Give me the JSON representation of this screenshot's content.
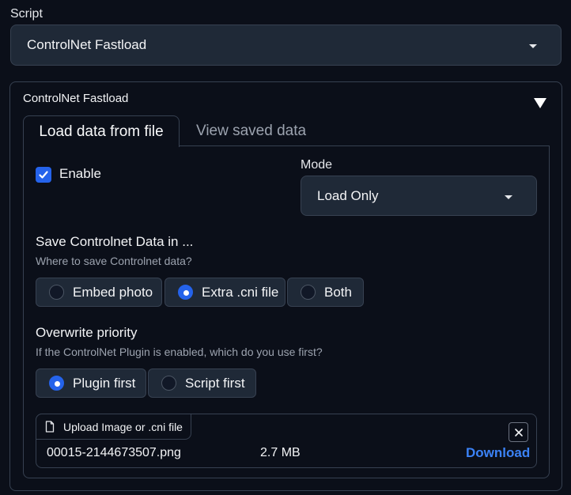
{
  "script": {
    "label": "Script",
    "selected": "ControlNet Fastload"
  },
  "accordion": {
    "title": "ControlNet Fastload"
  },
  "tabs": [
    {
      "label": "Load data from file",
      "active": true
    },
    {
      "label": "View saved data",
      "active": false
    }
  ],
  "enable": {
    "label": "Enable",
    "checked": true
  },
  "mode": {
    "label": "Mode",
    "selected": "Load Only"
  },
  "save_in": {
    "title": "Save Controlnet Data in ...",
    "info": "Where to save Controlnet data?",
    "options": [
      {
        "label": "Embed photo",
        "checked": false
      },
      {
        "label": "Extra .cni file",
        "checked": true
      },
      {
        "label": "Both",
        "checked": false
      }
    ]
  },
  "overwrite": {
    "title": "Overwrite priority",
    "info": "If the ControlNet Plugin is enabled, which do you use first?",
    "options": [
      {
        "label": "Plugin first",
        "checked": true
      },
      {
        "label": "Script first",
        "checked": false
      }
    ]
  },
  "upload": {
    "badge": "Upload Image or .cni file",
    "file_name": "00015-2144673507.png",
    "file_size": "2.7 MB",
    "download_label": "Download"
  },
  "colors": {
    "background": "#0b0f19",
    "panel": "#1f2937",
    "border": "#374151",
    "accent": "#2563eb",
    "link": "#3b82f6"
  }
}
